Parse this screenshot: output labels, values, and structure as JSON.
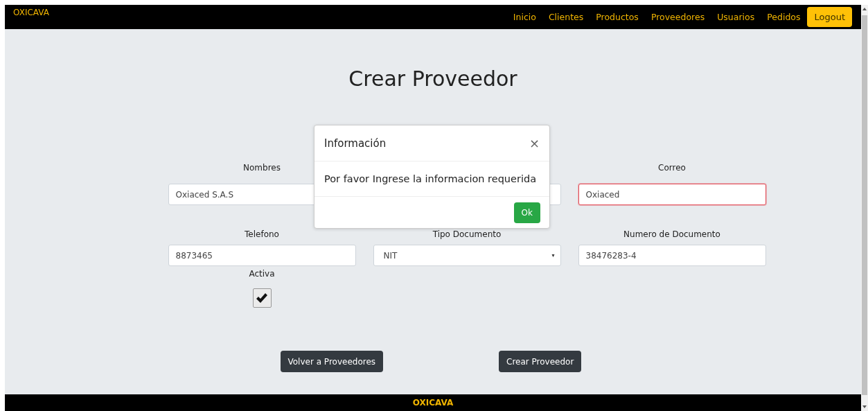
{
  "navbar": {
    "brand": "OXICAVA",
    "links": [
      {
        "label": "Inicio"
      },
      {
        "label": "Clientes"
      },
      {
        "label": "Productos"
      },
      {
        "label": "Proveedores"
      },
      {
        "label": "Usuarios"
      },
      {
        "label": "Pedidos"
      }
    ],
    "logout": "Logout"
  },
  "page_title": "Crear Proveedor",
  "form": {
    "fields": [
      {
        "kind": "text",
        "label": "Nombres",
        "value": "Oxiaced S.A.S",
        "invalid": false
      },
      {
        "kind": "text",
        "invalid": false
      },
      {
        "kind": "text",
        "label": "Correo",
        "value": "Oxiaced",
        "invalid": true
      },
      {
        "kind": "text",
        "label": "Telefono",
        "value": "8873465",
        "invalid": false
      },
      {
        "kind": "select",
        "label": "Tipo Documento",
        "value": "NIT",
        "caret": "▾",
        "invalid": false
      },
      {
        "kind": "text",
        "label": "Numero de Documento",
        "value": "38476283-4",
        "invalid": false
      }
    ],
    "checkbox": {
      "label": "Activa",
      "checked": true
    },
    "buttons": [
      "Volver a Proveedores",
      "Crear Proveedor"
    ]
  },
  "modal": {
    "title": "Información",
    "close": "×",
    "message": "Por favor Ingrese la informacion requerida",
    "ok": "Ok"
  },
  "footer": "OXICAVA"
}
